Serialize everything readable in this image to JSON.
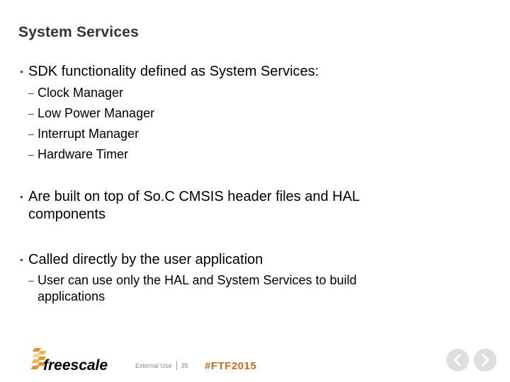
{
  "slide": {
    "title": "System Services",
    "bullets": [
      {
        "text": "SDK functionality defined as System Services:",
        "subitems": [
          "Clock Manager",
          "Low Power Manager",
          "Interrupt Manager",
          "Hardware Timer"
        ]
      },
      {
        "text": "Are built on top of So.C CMSIS header files and HAL components",
        "subitems": []
      },
      {
        "text": "Called directly by the user application",
        "subitems": [
          "User can use only the HAL and System Services to build applications"
        ]
      }
    ],
    "bullet_glyph": "•",
    "sub_glyph": "–"
  },
  "footer": {
    "logo_text": "freescale",
    "classification": "External Use",
    "page_number": "35",
    "hashtag": "#FTF2015",
    "hashtag_color": "#d2691e",
    "logo_colors": [
      "#f28c28",
      "#f5b041",
      "#fbd38d"
    ]
  },
  "navigation": {
    "prev_icon": "chevron-left-icon",
    "next_icon": "chevron-right-icon"
  }
}
